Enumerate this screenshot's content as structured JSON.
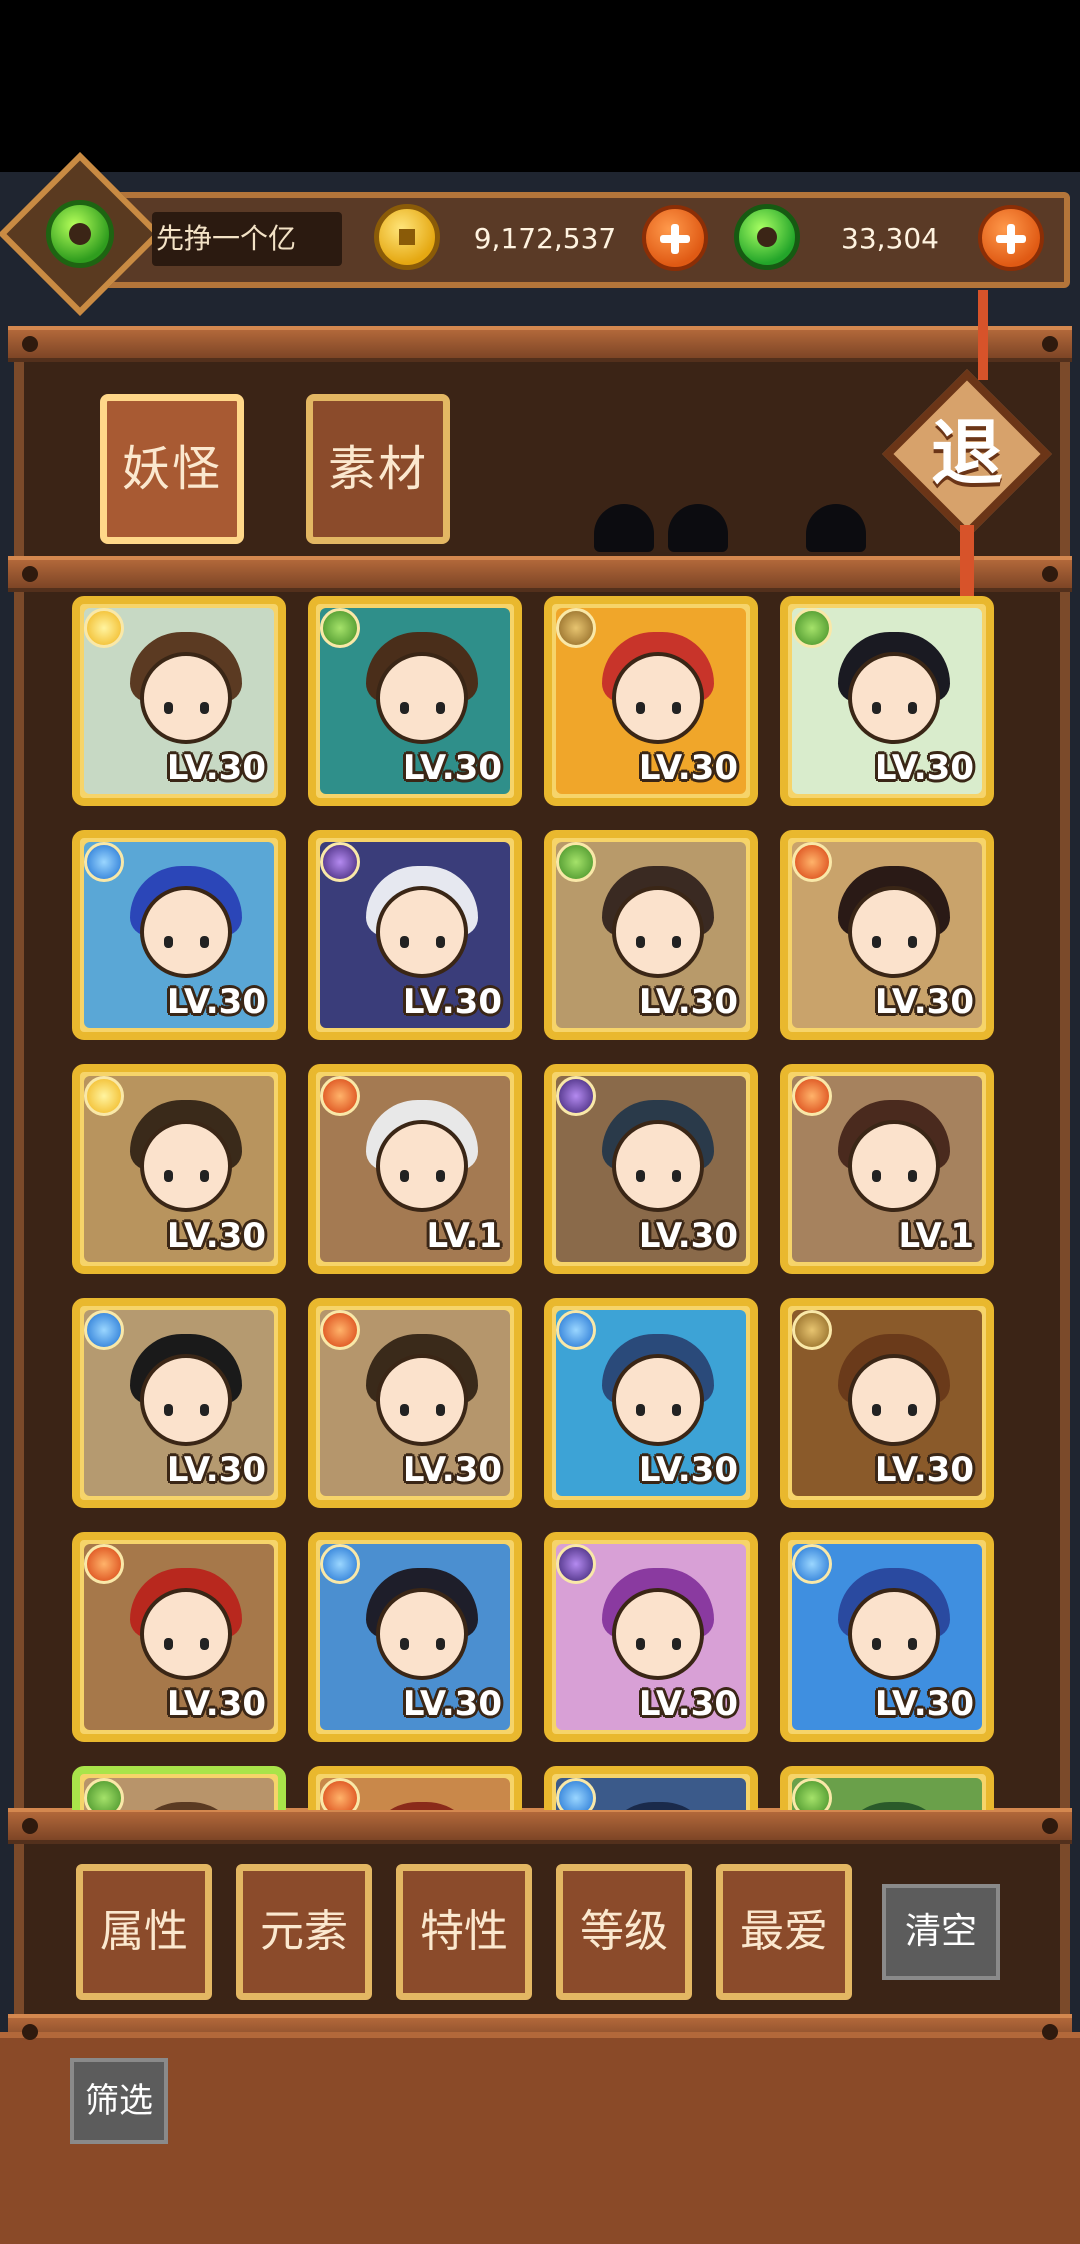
{
  "header": {
    "player_name": "先挣一个亿",
    "gold": "9,172,537",
    "jade": "33,304"
  },
  "tabs": [
    {
      "label": "妖怪",
      "active": true
    },
    {
      "label": "素材",
      "active": false
    }
  ],
  "exit_label": "退",
  "colors": {
    "gold": "#e9b82e",
    "wood_dark": "#3b2416",
    "wood": "#8b4b2b",
    "accent_orange": "#e05a14"
  },
  "cards": [
    {
      "element": "light",
      "level": "LV.30",
      "hair": "#5b3a22",
      "bg": "#c7d9c4"
    },
    {
      "element": "wood",
      "level": "LV.30",
      "hair": "#4a2e1a",
      "bg": "#2f8f8a"
    },
    {
      "element": "earth",
      "level": "LV.30",
      "hair": "#c8342a",
      "bg": "#f0a62a"
    },
    {
      "element": "wood",
      "level": "LV.30",
      "hair": "#1a1a22",
      "bg": "#d9eccc"
    },
    {
      "element": "water",
      "level": "LV.30",
      "hair": "#2b46b8",
      "bg": "#5aa7d6"
    },
    {
      "element": "dark",
      "level": "LV.30",
      "hair": "#e6e8f0",
      "bg": "#3a3d7a"
    },
    {
      "element": "wood",
      "level": "LV.30",
      "hair": "#3a2a22",
      "bg": "#b89a6a"
    },
    {
      "element": "fire",
      "level": "LV.30",
      "hair": "#2a1a16",
      "bg": "#c9a36b"
    },
    {
      "element": "light",
      "level": "LV.30",
      "hair": "#3a2a1a",
      "bg": "#b8945e"
    },
    {
      "element": "fire",
      "level": "LV.1",
      "hair": "#e8e8e8",
      "bg": "#a47a52"
    },
    {
      "element": "dark",
      "level": "LV.30",
      "hair": "#2a3a4a",
      "bg": "#8a6a4a"
    },
    {
      "element": "fire",
      "level": "LV.1",
      "hair": "#4a2a1e",
      "bg": "#a6825e"
    },
    {
      "element": "water",
      "level": "LV.30",
      "hair": "#1a1a1a",
      "bg": "#b59a70"
    },
    {
      "element": "fire",
      "level": "LV.30",
      "hair": "#3a2a1a",
      "bg": "#b5966c"
    },
    {
      "element": "water",
      "level": "LV.30",
      "hair": "#2a4a7a",
      "bg": "#3da3d6"
    },
    {
      "element": "earth",
      "level": "LV.30",
      "hair": "#6a3a1a",
      "bg": "#8a5a2a"
    },
    {
      "element": "fire",
      "level": "LV.30",
      "hair": "#b8281e",
      "bg": "#a6784a"
    },
    {
      "element": "water",
      "level": "LV.30",
      "hair": "#1e1e2a",
      "bg": "#4b8fd0"
    },
    {
      "element": "dark",
      "level": "LV.30",
      "hair": "#8a3aa0",
      "bg": "#d8a0d6"
    },
    {
      "element": "water",
      "level": "LV.30",
      "hair": "#2a4aa0",
      "bg": "#3f8fe0"
    },
    {
      "element": "wood",
      "level": "",
      "hair": "#5a3a22",
      "bg": "#b8946a"
    },
    {
      "element": "fire",
      "level": "",
      "hair": "#8a2a1a",
      "bg": "#c9884a"
    },
    {
      "element": "water",
      "level": "",
      "hair": "#1a2a4a",
      "bg": "#3b5a8a"
    },
    {
      "element": "wood",
      "level": "",
      "hair": "#2a5a2a",
      "bg": "#6aa04a"
    }
  ],
  "filters": [
    {
      "label": "属性"
    },
    {
      "label": "元素"
    },
    {
      "label": "特性"
    },
    {
      "label": "等级"
    },
    {
      "label": "最爱"
    }
  ],
  "clear_label": "清空",
  "screen_label": "筛选"
}
